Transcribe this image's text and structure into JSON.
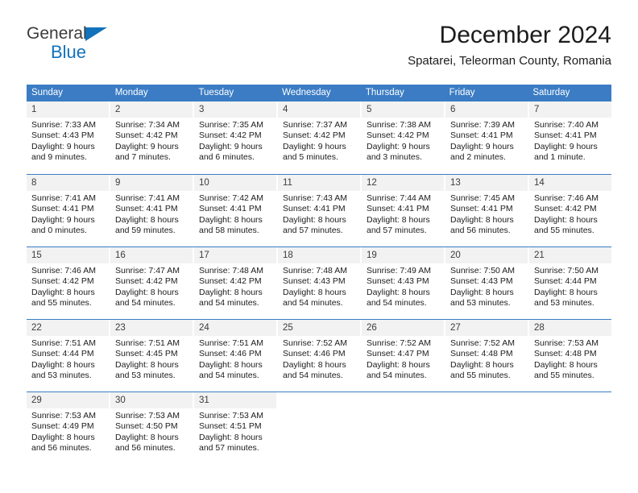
{
  "brand": {
    "name_part1": "General",
    "name_part2": "Blue",
    "triangle_color": "#1272bb"
  },
  "header": {
    "title": "December 2024",
    "subtitle": "Spatarei, Teleorman County, Romania"
  },
  "theme": {
    "header_blue": "#3b7cc4",
    "day_band_gray": "#f2f2f2",
    "text": "#1c1c1c"
  },
  "weekdays": [
    "Sunday",
    "Monday",
    "Tuesday",
    "Wednesday",
    "Thursday",
    "Friday",
    "Saturday"
  ],
  "weeks": [
    [
      {
        "day": "1",
        "sunrise": "Sunrise: 7:33 AM",
        "sunset": "Sunset: 4:43 PM",
        "daylight_line1": "Daylight: 9 hours",
        "daylight_line2": "and 9 minutes."
      },
      {
        "day": "2",
        "sunrise": "Sunrise: 7:34 AM",
        "sunset": "Sunset: 4:42 PM",
        "daylight_line1": "Daylight: 9 hours",
        "daylight_line2": "and 7 minutes."
      },
      {
        "day": "3",
        "sunrise": "Sunrise: 7:35 AM",
        "sunset": "Sunset: 4:42 PM",
        "daylight_line1": "Daylight: 9 hours",
        "daylight_line2": "and 6 minutes."
      },
      {
        "day": "4",
        "sunrise": "Sunrise: 7:37 AM",
        "sunset": "Sunset: 4:42 PM",
        "daylight_line1": "Daylight: 9 hours",
        "daylight_line2": "and 5 minutes."
      },
      {
        "day": "5",
        "sunrise": "Sunrise: 7:38 AM",
        "sunset": "Sunset: 4:42 PM",
        "daylight_line1": "Daylight: 9 hours",
        "daylight_line2": "and 3 minutes."
      },
      {
        "day": "6",
        "sunrise": "Sunrise: 7:39 AM",
        "sunset": "Sunset: 4:41 PM",
        "daylight_line1": "Daylight: 9 hours",
        "daylight_line2": "and 2 minutes."
      },
      {
        "day": "7",
        "sunrise": "Sunrise: 7:40 AM",
        "sunset": "Sunset: 4:41 PM",
        "daylight_line1": "Daylight: 9 hours",
        "daylight_line2": "and 1 minute."
      }
    ],
    [
      {
        "day": "8",
        "sunrise": "Sunrise: 7:41 AM",
        "sunset": "Sunset: 4:41 PM",
        "daylight_line1": "Daylight: 9 hours",
        "daylight_line2": "and 0 minutes."
      },
      {
        "day": "9",
        "sunrise": "Sunrise: 7:41 AM",
        "sunset": "Sunset: 4:41 PM",
        "daylight_line1": "Daylight: 8 hours",
        "daylight_line2": "and 59 minutes."
      },
      {
        "day": "10",
        "sunrise": "Sunrise: 7:42 AM",
        "sunset": "Sunset: 4:41 PM",
        "daylight_line1": "Daylight: 8 hours",
        "daylight_line2": "and 58 minutes."
      },
      {
        "day": "11",
        "sunrise": "Sunrise: 7:43 AM",
        "sunset": "Sunset: 4:41 PM",
        "daylight_line1": "Daylight: 8 hours",
        "daylight_line2": "and 57 minutes."
      },
      {
        "day": "12",
        "sunrise": "Sunrise: 7:44 AM",
        "sunset": "Sunset: 4:41 PM",
        "daylight_line1": "Daylight: 8 hours",
        "daylight_line2": "and 57 minutes."
      },
      {
        "day": "13",
        "sunrise": "Sunrise: 7:45 AM",
        "sunset": "Sunset: 4:41 PM",
        "daylight_line1": "Daylight: 8 hours",
        "daylight_line2": "and 56 minutes."
      },
      {
        "day": "14",
        "sunrise": "Sunrise: 7:46 AM",
        "sunset": "Sunset: 4:42 PM",
        "daylight_line1": "Daylight: 8 hours",
        "daylight_line2": "and 55 minutes."
      }
    ],
    [
      {
        "day": "15",
        "sunrise": "Sunrise: 7:46 AM",
        "sunset": "Sunset: 4:42 PM",
        "daylight_line1": "Daylight: 8 hours",
        "daylight_line2": "and 55 minutes."
      },
      {
        "day": "16",
        "sunrise": "Sunrise: 7:47 AM",
        "sunset": "Sunset: 4:42 PM",
        "daylight_line1": "Daylight: 8 hours",
        "daylight_line2": "and 54 minutes."
      },
      {
        "day": "17",
        "sunrise": "Sunrise: 7:48 AM",
        "sunset": "Sunset: 4:42 PM",
        "daylight_line1": "Daylight: 8 hours",
        "daylight_line2": "and 54 minutes."
      },
      {
        "day": "18",
        "sunrise": "Sunrise: 7:48 AM",
        "sunset": "Sunset: 4:43 PM",
        "daylight_line1": "Daylight: 8 hours",
        "daylight_line2": "and 54 minutes."
      },
      {
        "day": "19",
        "sunrise": "Sunrise: 7:49 AM",
        "sunset": "Sunset: 4:43 PM",
        "daylight_line1": "Daylight: 8 hours",
        "daylight_line2": "and 54 minutes."
      },
      {
        "day": "20",
        "sunrise": "Sunrise: 7:50 AM",
        "sunset": "Sunset: 4:43 PM",
        "daylight_line1": "Daylight: 8 hours",
        "daylight_line2": "and 53 minutes."
      },
      {
        "day": "21",
        "sunrise": "Sunrise: 7:50 AM",
        "sunset": "Sunset: 4:44 PM",
        "daylight_line1": "Daylight: 8 hours",
        "daylight_line2": "and 53 minutes."
      }
    ],
    [
      {
        "day": "22",
        "sunrise": "Sunrise: 7:51 AM",
        "sunset": "Sunset: 4:44 PM",
        "daylight_line1": "Daylight: 8 hours",
        "daylight_line2": "and 53 minutes."
      },
      {
        "day": "23",
        "sunrise": "Sunrise: 7:51 AM",
        "sunset": "Sunset: 4:45 PM",
        "daylight_line1": "Daylight: 8 hours",
        "daylight_line2": "and 53 minutes."
      },
      {
        "day": "24",
        "sunrise": "Sunrise: 7:51 AM",
        "sunset": "Sunset: 4:46 PM",
        "daylight_line1": "Daylight: 8 hours",
        "daylight_line2": "and 54 minutes."
      },
      {
        "day": "25",
        "sunrise": "Sunrise: 7:52 AM",
        "sunset": "Sunset: 4:46 PM",
        "daylight_line1": "Daylight: 8 hours",
        "daylight_line2": "and 54 minutes."
      },
      {
        "day": "26",
        "sunrise": "Sunrise: 7:52 AM",
        "sunset": "Sunset: 4:47 PM",
        "daylight_line1": "Daylight: 8 hours",
        "daylight_line2": "and 54 minutes."
      },
      {
        "day": "27",
        "sunrise": "Sunrise: 7:52 AM",
        "sunset": "Sunset: 4:48 PM",
        "daylight_line1": "Daylight: 8 hours",
        "daylight_line2": "and 55 minutes."
      },
      {
        "day": "28",
        "sunrise": "Sunrise: 7:53 AM",
        "sunset": "Sunset: 4:48 PM",
        "daylight_line1": "Daylight: 8 hours",
        "daylight_line2": "and 55 minutes."
      }
    ],
    [
      {
        "day": "29",
        "sunrise": "Sunrise: 7:53 AM",
        "sunset": "Sunset: 4:49 PM",
        "daylight_line1": "Daylight: 8 hours",
        "daylight_line2": "and 56 minutes."
      },
      {
        "day": "30",
        "sunrise": "Sunrise: 7:53 AM",
        "sunset": "Sunset: 4:50 PM",
        "daylight_line1": "Daylight: 8 hours",
        "daylight_line2": "and 56 minutes."
      },
      {
        "day": "31",
        "sunrise": "Sunrise: 7:53 AM",
        "sunset": "Sunset: 4:51 PM",
        "daylight_line1": "Daylight: 8 hours",
        "daylight_line2": "and 57 minutes."
      },
      {
        "day": "",
        "sunrise": "",
        "sunset": "",
        "daylight_line1": "",
        "daylight_line2": ""
      },
      {
        "day": "",
        "sunrise": "",
        "sunset": "",
        "daylight_line1": "",
        "daylight_line2": ""
      },
      {
        "day": "",
        "sunrise": "",
        "sunset": "",
        "daylight_line1": "",
        "daylight_line2": ""
      },
      {
        "day": "",
        "sunrise": "",
        "sunset": "",
        "daylight_line1": "",
        "daylight_line2": ""
      }
    ]
  ]
}
